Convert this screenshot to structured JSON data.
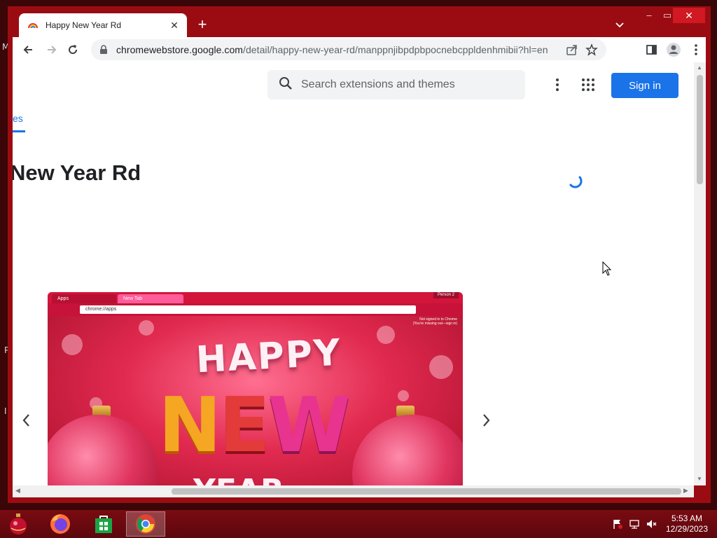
{
  "desktop": {
    "edge_letters": [
      "M",
      "P",
      "I"
    ]
  },
  "browser": {
    "tab": {
      "title": "Happy New Year Rd",
      "favicon": "rainbow-theme-icon"
    },
    "new_tab_label": "+",
    "window_controls": {
      "minimize": "–",
      "maximize": "▭",
      "close": "✕"
    },
    "address_bar": {
      "host": "chromewebstore.google.com",
      "path": "/detail/happy-new-year-rd/manppnjibpdpbpocnebcppldenhmibii?hl=en"
    }
  },
  "page": {
    "search_placeholder": "Search extensions and themes",
    "sign_in_label": "Sign in",
    "tab_partial_label": "es",
    "title": "New Year Rd",
    "carousel": {
      "preview": {
        "tab1": "Apps",
        "tab2": "New Tab",
        "person": "Person 2",
        "url": "chrome://apps",
        "notice_line1": "Not signed in to Chrome",
        "notice_line2": "(You're missing out—sign in)",
        "headline_top": "HAPPY",
        "headline_mid": [
          "N",
          "E",
          "W"
        ],
        "headline_bottom": "YEAR"
      }
    }
  },
  "taskbar": {
    "apps": [
      "start-ornament-icon",
      "firefox-icon",
      "store-icon",
      "chrome-icon"
    ],
    "active_app": "chrome-icon",
    "clock": {
      "time": "5:53 AM",
      "date": "12/29/2023"
    }
  },
  "colors": {
    "window_frame": "#9b0c12",
    "accent_blue": "#1a73e8",
    "taskbar": "#6b0910"
  }
}
